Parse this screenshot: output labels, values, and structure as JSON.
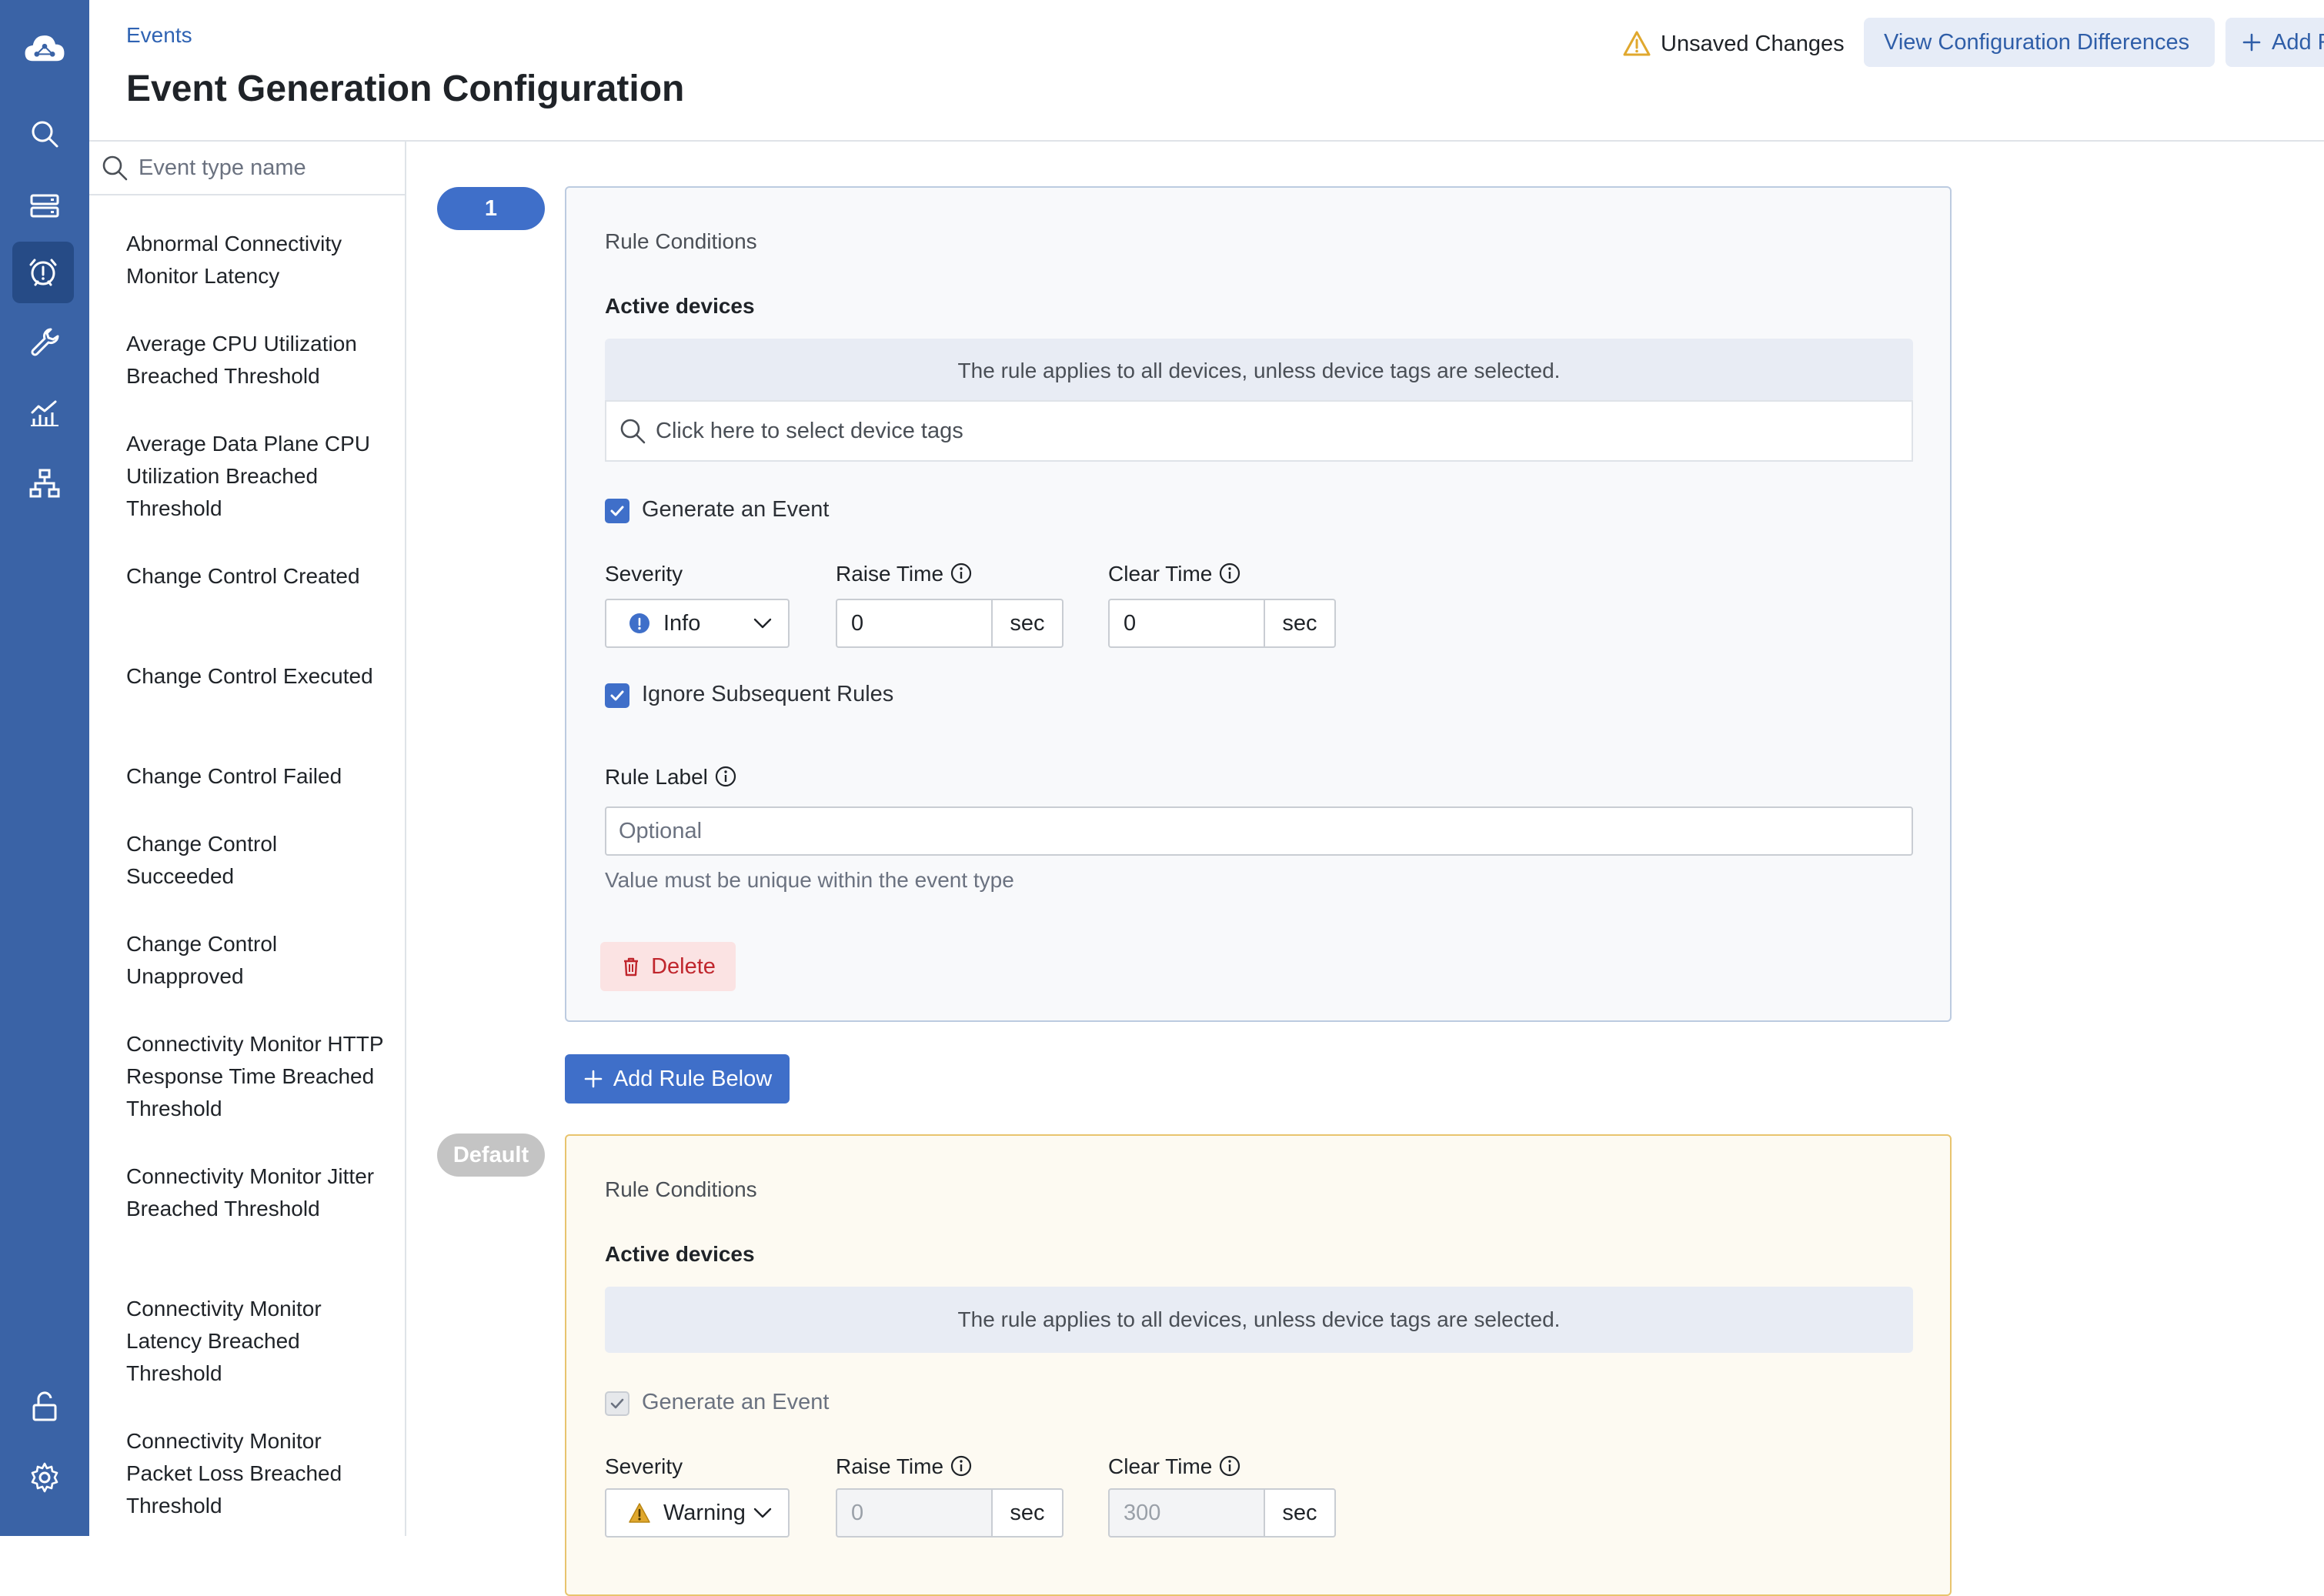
{
  "header": {
    "breadcrumb": "Events",
    "title": "Event Generation Configuration",
    "unsaved_label": "Unsaved Changes",
    "view_diff_label": "View Configuration Differences",
    "add_label": "Add R"
  },
  "nav": {
    "items": [
      "cloud-logo-icon",
      "search-icon",
      "devices-icon",
      "events-alarm-icon",
      "tools-icon",
      "metrics-icon",
      "topology-icon",
      "lock-icon",
      "settings-icon"
    ],
    "active": "events-alarm-icon"
  },
  "sidebar": {
    "search_placeholder": "Event type name",
    "items": [
      "Abnormal Connectivity Monitor Latency",
      "Average CPU Utilization Breached Threshold",
      "Average Data Plane CPU Utilization Breached Threshold",
      "Change Control Created",
      "Change Control Executed",
      "Change Control Failed",
      "Change Control Succeeded",
      "Change Control Unapproved",
      "Connectivity Monitor HTTP Response Time Breached Threshold",
      "Connectivity Monitor Jitter Breached Threshold",
      "Connectivity Monitor Latency Breached Threshold",
      "Connectivity Monitor Packet Loss Breached Threshold"
    ]
  },
  "rule1": {
    "badge": "1",
    "conditions_title": "Rule Conditions",
    "active_devices_label": "Active devices",
    "banner": "The rule applies to all devices, unless device tags are selected.",
    "tag_placeholder": "Click here to select device tags",
    "generate_event_label": "Generate an Event",
    "generate_event_checked": true,
    "severity_label": "Severity",
    "severity_value": "Info",
    "raise_time_label": "Raise Time",
    "raise_time_value": "0",
    "clear_time_label": "Clear Time",
    "clear_time_value": "0",
    "unit": "sec",
    "ignore_label": "Ignore Subsequent Rules",
    "ignore_checked": true,
    "rule_label_title": "Rule Label",
    "rule_label_placeholder": "Optional",
    "rule_label_hint": "Value must be unique within the event type",
    "delete_label": "Delete"
  },
  "add_rule_below_label": "Add Rule Below",
  "default_rule": {
    "badge": "Default",
    "conditions_title": "Rule Conditions",
    "active_devices_label": "Active devices",
    "banner": "The rule applies to all devices, unless device tags are selected.",
    "generate_event_label": "Generate an Event",
    "severity_label": "Severity",
    "severity_value": "Warning",
    "raise_time_label": "Raise Time",
    "raise_time_value": "0",
    "clear_time_label": "Clear Time",
    "clear_time_value": "300",
    "unit": "sec"
  },
  "colors": {
    "nav_bg": "#3a63a6",
    "accent": "#3f6fc9",
    "warning": "#e0a82e",
    "danger": "#c0262d"
  }
}
